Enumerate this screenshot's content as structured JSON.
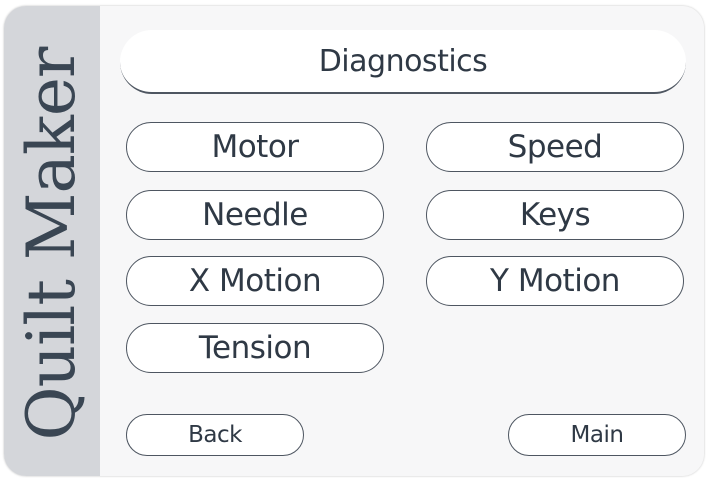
{
  "brand": {
    "name": "Quilt Maker"
  },
  "screen": {
    "title": "Diagnostics"
  },
  "menu": {
    "motor": "Motor",
    "speed": "Speed",
    "needle": "Needle",
    "keys": "Keys",
    "x_motion": "X Motion",
    "y_motion": "Y Motion",
    "tension": "Tension"
  },
  "nav": {
    "back": "Back",
    "main": "Main"
  },
  "colors": {
    "brand_panel": "#d4d6da",
    "brand_text": "#3a4653",
    "button_border": "#4e5661",
    "button_text": "#2f3945"
  }
}
